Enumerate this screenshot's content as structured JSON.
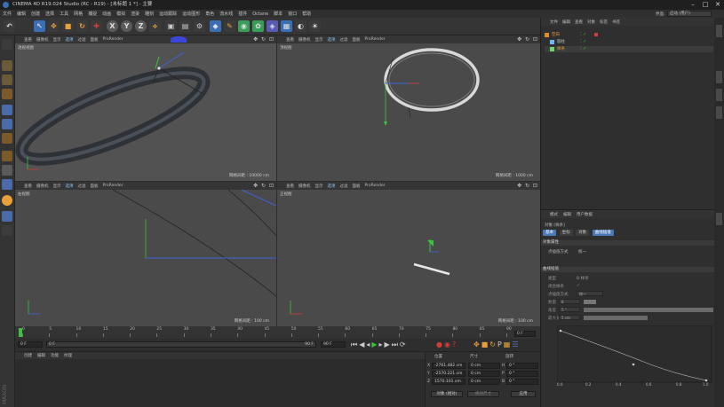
{
  "window": {
    "title": "CINEMA 4D R19.024 Studio (RC - R19) - [未标题 1 *] - 主要",
    "layout_label": "界面:",
    "layout_value": "启动 (用户)"
  },
  "menu": [
    "文件",
    "编辑",
    "创建",
    "选择",
    "工具",
    "网格",
    "捕捉",
    "动画",
    "模拟",
    "渲染",
    "雕刻",
    "运动跟踪",
    "运动图形",
    "角色",
    "流水线",
    "插件",
    "Octane",
    "脚本",
    "窗口",
    "帮助"
  ],
  "viewports": [
    {
      "label": "透视视图",
      "grid": "网格间距 : 10000 cm",
      "menu": [
        "查看",
        "摄像机",
        "显示",
        "选项",
        "过滤",
        "面板",
        "ProRender"
      ]
    },
    {
      "label": "顶视图",
      "grid": "网格间距 : 1000 cm",
      "menu": [
        "查看",
        "摄像机",
        "显示",
        "选项",
        "过滤",
        "面板",
        "ProRender"
      ]
    },
    {
      "label": "右视图",
      "grid": "网格间距 : 100 cm",
      "menu": [
        "查看",
        "摄像机",
        "显示",
        "选项",
        "过滤",
        "面板",
        "ProRender"
      ]
    },
    {
      "label": "正视图",
      "grid": "网格间距 : 100 cm",
      "menu": [
        "查看",
        "摄像机",
        "显示",
        "选项",
        "过滤",
        "面板",
        "ProRender"
      ]
    }
  ],
  "timeline": {
    "ticks": [
      "0",
      "5",
      "10",
      "15",
      "20",
      "25",
      "30",
      "35",
      "40",
      "45",
      "50",
      "55",
      "60",
      "65",
      "70",
      "75",
      "80",
      "85",
      "90"
    ],
    "end_label": "0 F"
  },
  "transport": {
    "start": "0 F",
    "slider_start": "0 F",
    "slider_end": "90 F",
    "end": "90 F"
  },
  "materials": {
    "tabs": [
      "创建",
      "编辑",
      "功能",
      "纹理"
    ]
  },
  "coords": {
    "headers": [
      "位置",
      "尺寸",
      "旋转"
    ],
    "rows": [
      {
        "axis": "X",
        "pos": "-2761.482 cm",
        "size": "0 cm",
        "rot_axis": "H",
        "rot": "0 °"
      },
      {
        "axis": "Y",
        "pos": "-2570.221 cm",
        "size": "0 cm",
        "rot_axis": "P",
        "rot": "0 °"
      },
      {
        "axis": "Z",
        "pos": "1570.101 cm",
        "size": "0 cm",
        "rot_axis": "B",
        "rot": "0 °"
      }
    ],
    "mode": "对象 (相对)",
    "size_mode": "绝对尺寸",
    "apply": "应用"
  },
  "objects": {
    "menu": [
      "文件",
      "编辑",
      "查看",
      "对象",
      "标签",
      "书签"
    ],
    "items": [
      {
        "name": "空白",
        "color": "#e08a2a",
        "indent": 0
      },
      {
        "name": "圆柱",
        "color": "#6fb3ff",
        "indent": 1
      },
      {
        "name": "样条",
        "color": "#6fd46f",
        "indent": 1
      }
    ]
  },
  "attributes": {
    "menu": [
      "模式",
      "编辑",
      "用户数据"
    ],
    "object_name": "对象 [样条]",
    "tabs": [
      "基本",
      "坐标",
      "对象",
      "曲线插值"
    ],
    "tab_active": 3,
    "section1": "对象属性",
    "point_interp_label": "点插值方式",
    "point_interp_value": "统一",
    "section2": "曲线插值",
    "rows": [
      {
        "label": "类型",
        "value": "B-样条"
      },
      {
        "label": "闭合样条",
        "value": "✓"
      },
      {
        "label": "点插值方式",
        "value": "统一"
      },
      {
        "label": "数量",
        "value": "8"
      },
      {
        "label": "角度",
        "value": "5 °"
      },
      {
        "label": "最大长度",
        "value": "5 cm"
      }
    ],
    "curve_axis": [
      "0.0",
      "0.2",
      "0.4",
      "0.6",
      "0.8",
      "1.0"
    ]
  },
  "colors": {
    "accent": "#4a79b8",
    "spline": "#6fd46f",
    "axis_red": "#d23c3c",
    "axis_blue": "#3c66d8"
  }
}
